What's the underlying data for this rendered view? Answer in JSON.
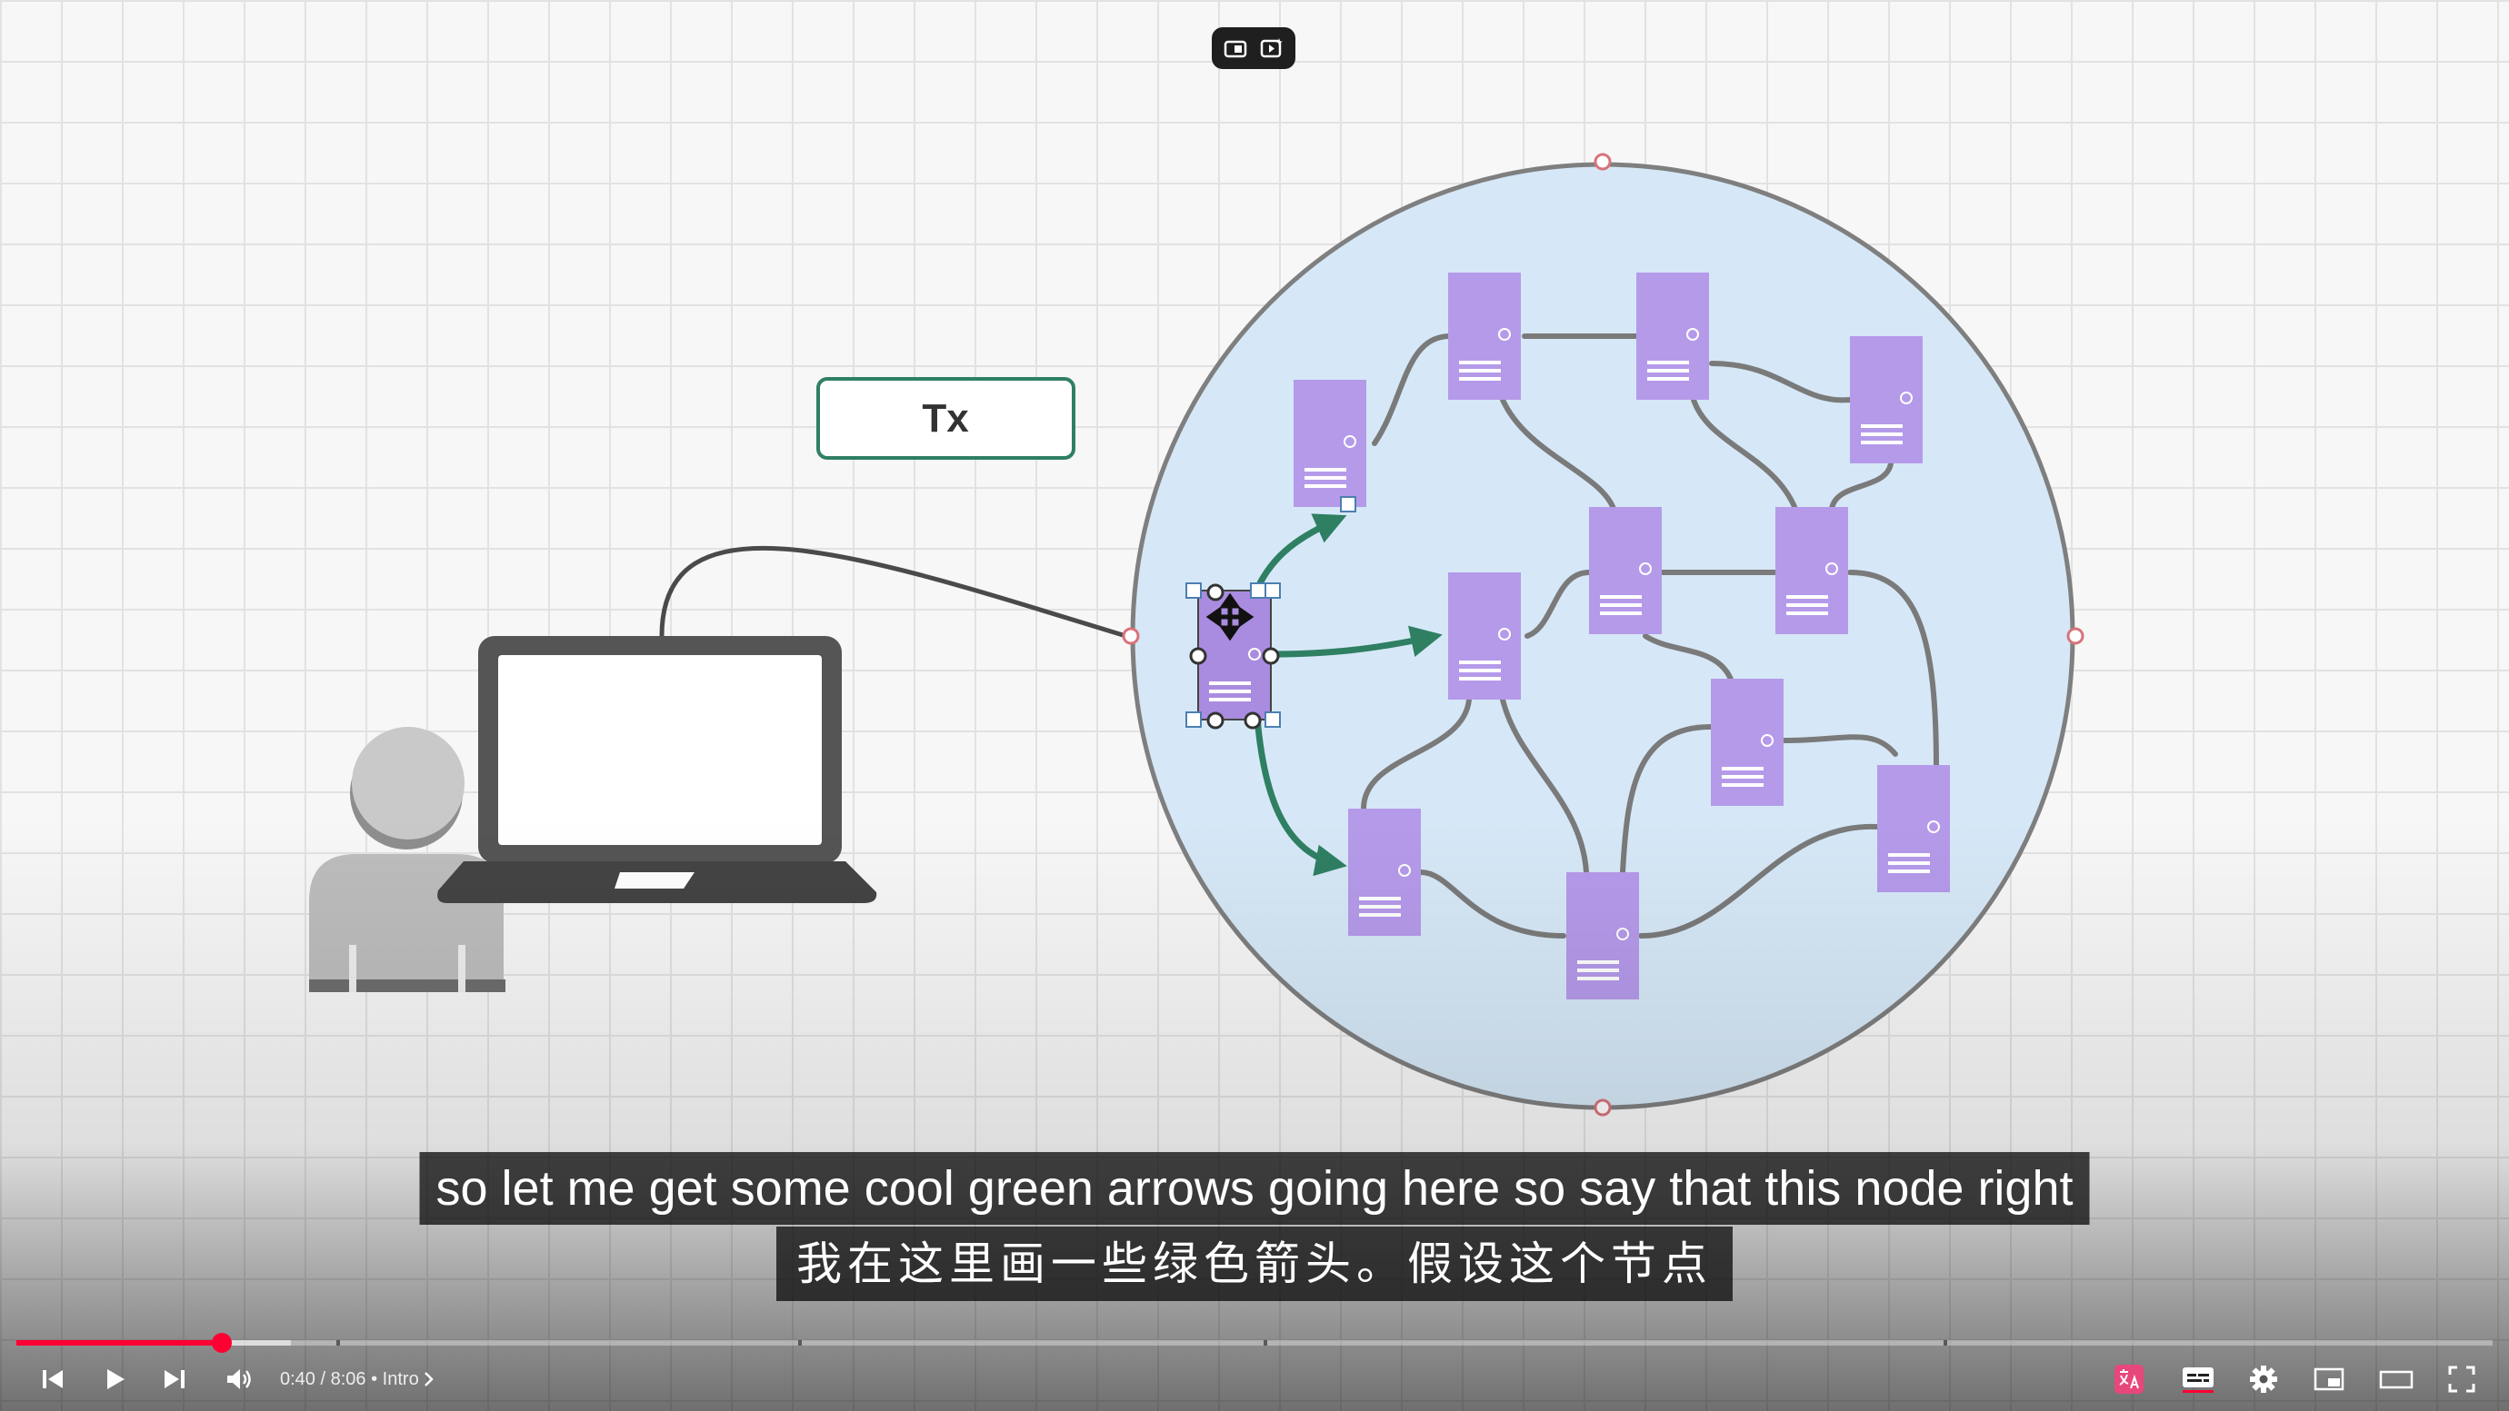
{
  "diagram": {
    "tx_label": "Tx",
    "colors": {
      "server": "#b59aea",
      "network_fill": "#d6e8f7",
      "green_arrow": "#2f7f63",
      "tx_border": "#2f7f63",
      "grid": "#e2e2e2"
    }
  },
  "captions": {
    "english": "so let me get some cool green arrows going here so say that this node right",
    "chinese": "我在这里画一些绿色箭头。假设这个节点"
  },
  "player": {
    "current_time": "0:40",
    "time_separator": " / ",
    "duration": "8:06",
    "chapter_separator": " • ",
    "chapter": "Intro",
    "progress_fraction": 0.083,
    "buffered_fraction": 0.111,
    "accent_color": "#ff0033",
    "icons": {
      "prev": "skip-previous-icon",
      "play": "play-icon",
      "next": "skip-next-icon",
      "volume": "volume-icon",
      "auto_translate": "auto-translate-icon",
      "subtitles": "subtitles-icon",
      "settings": "gear-icon",
      "miniplayer": "miniplayer-icon",
      "theater": "theater-mode-icon",
      "fullscreen": "fullscreen-icon"
    }
  }
}
